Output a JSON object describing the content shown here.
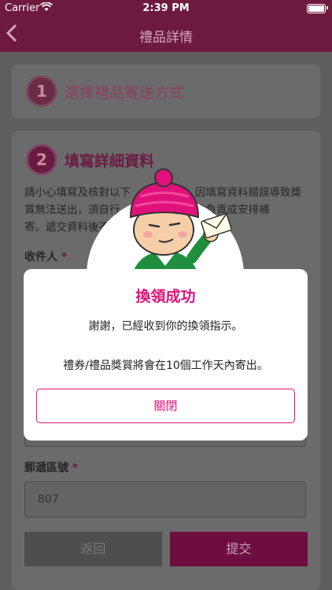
{
  "status_bar": {
    "carrier": "Carrier",
    "time": "2:39 PM"
  },
  "nav": {
    "back_icon": "chevron-left-icon",
    "title": "禮品詳情"
  },
  "step1": {
    "number": "1",
    "title": "選擇禮品寄送方式"
  },
  "step2": {
    "number": "2",
    "title": "填寫詳細資料",
    "instructions_line1": "請小心填寫及核對以下",
    "instructions_line1b": "因填寫資料錯誤導致獎",
    "instructions_line2": "賞無法送出，須自行",
    "instructions_line2b": "不會負責或安排補",
    "instructions_line3": "寄。遞交資料後不"
  },
  "form": {
    "recipient_label": "收件人",
    "required_mark": "*",
    "postal_code_label": "郵遞區號",
    "postal_code_value": "807"
  },
  "buttons": {
    "back": "返回",
    "submit": "提交"
  },
  "modal": {
    "title": "換領成功",
    "message1": "謝謝，已經收到你的換領指示。",
    "message2": "禮券/禮品獎賞將會在10個工作天內寄出。",
    "close": "關閉"
  },
  "colors": {
    "accent": "#e0117a",
    "nav_bg": "#6e1a3f"
  }
}
